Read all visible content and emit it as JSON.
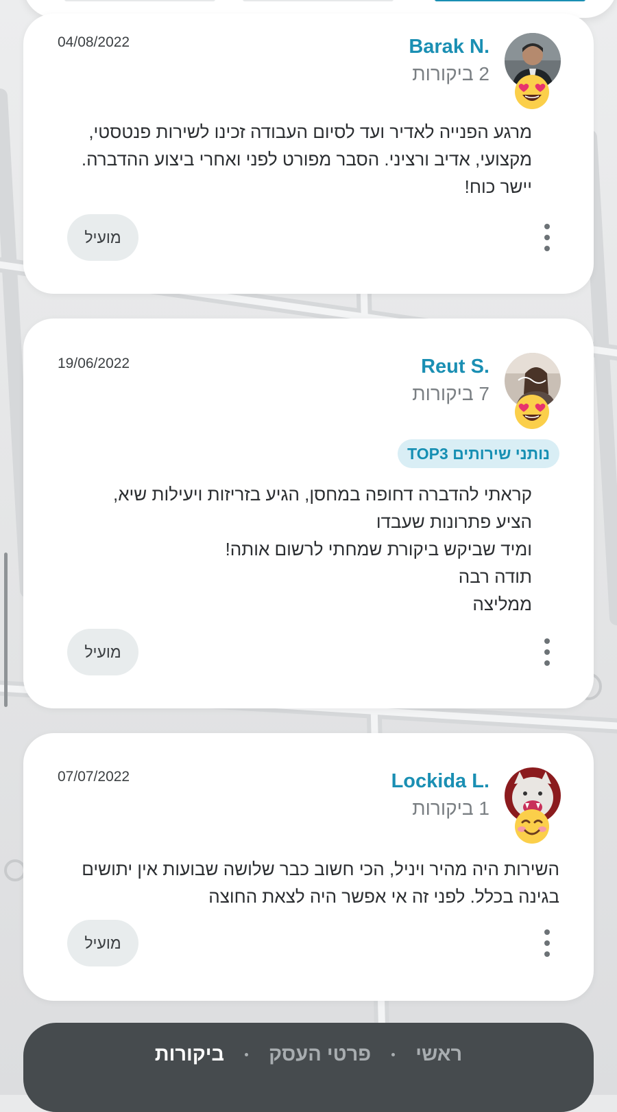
{
  "reviews": [
    {
      "name": "Barak N.",
      "review_count": "2 ביקורות",
      "date": "04/08/2022",
      "reaction": "heart-eyes",
      "badge": "",
      "text_lines": [
        "מרגע הפנייה לאדיר ועד לסיום העבודה זכינו לשירות פנטסטי,",
        "מקצועי, אדיב ורציני. הסבר מפורט לפני ואחרי ביצוע ההדברה.",
        "יישר כוח!"
      ],
      "helpful_label": "מועיל"
    },
    {
      "name": "Reut S.",
      "review_count": "7 ביקורות",
      "date": "19/06/2022",
      "reaction": "heart-eyes",
      "badge": "נותני שירותים TOP3",
      "text_lines": [
        "קראתי להדברה דחופה במחסן, הגיע בזריזות ויעילות שיא,",
        "הציע פתרונות שעבדו",
        "ומיד שביקש ביקורת שמחתי לרשום אותה!",
        "תודה רבה",
        "ממליצה"
      ],
      "helpful_label": "מועיל"
    },
    {
      "name": "Lockida L.",
      "review_count": "1 ביקורות",
      "date": "07/07/2022",
      "reaction": "smiling-face",
      "badge": "",
      "text_lines": [
        "השירות היה מהיר ויניל, הכי חשוב כבר שלושה שבועות אין יתושים",
        "בגינה בכלל. לפני זה אי אפשר היה לצאת החוצה"
      ],
      "helpful_label": "מועיל"
    }
  ],
  "bottom_nav": {
    "items": [
      "ראשי",
      "פרטי העסק",
      "ביקורות"
    ],
    "active": "ביקורות"
  },
  "colors": {
    "accent": "#1a8fb3",
    "badge_bg": "#d9eef5",
    "nav_bg": "#464b4e",
    "helpful_bg": "#e8eced"
  }
}
